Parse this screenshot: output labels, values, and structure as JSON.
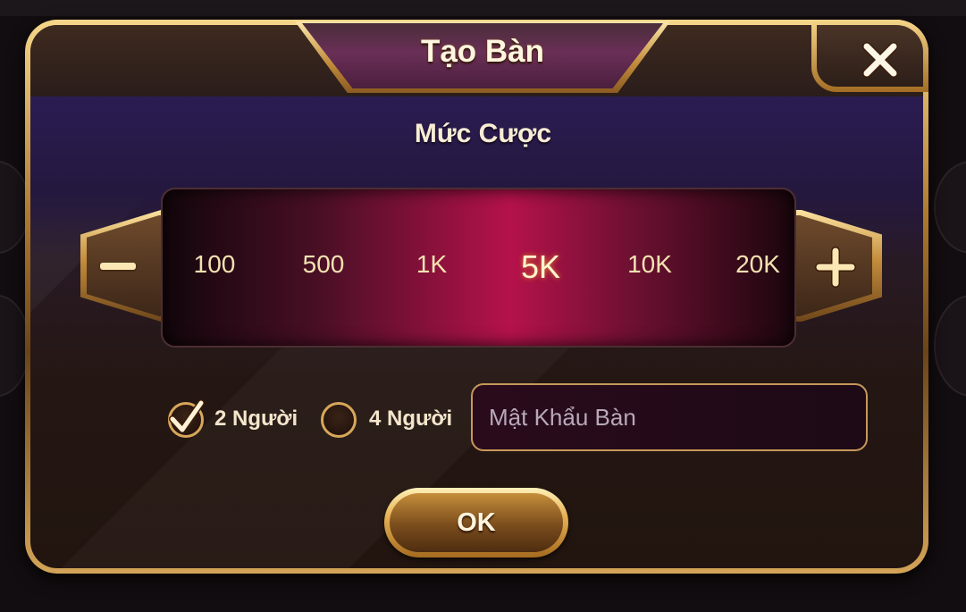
{
  "dialog": {
    "title": "Tạo Bàn",
    "bet_label": "Mức Cược"
  },
  "bet_selector": {
    "options": [
      "100",
      "500",
      "1K",
      "5K",
      "10K",
      "20K"
    ],
    "selected": "5K"
  },
  "players": {
    "option_2": {
      "label": "2 Người",
      "checked": true
    },
    "option_4": {
      "label": "4 Người",
      "checked": false
    }
  },
  "password": {
    "placeholder": "Mật Khẩu Bàn",
    "value": ""
  },
  "ok_button": {
    "label": "OK"
  },
  "icons": {
    "close": "close-icon",
    "decrease": "minus-icon",
    "increase": "plus-icon",
    "check": "check-icon"
  },
  "colors": {
    "gold": "#e7b354",
    "selected_band": "#b5124a",
    "panel_purple": "#2b1c52"
  }
}
